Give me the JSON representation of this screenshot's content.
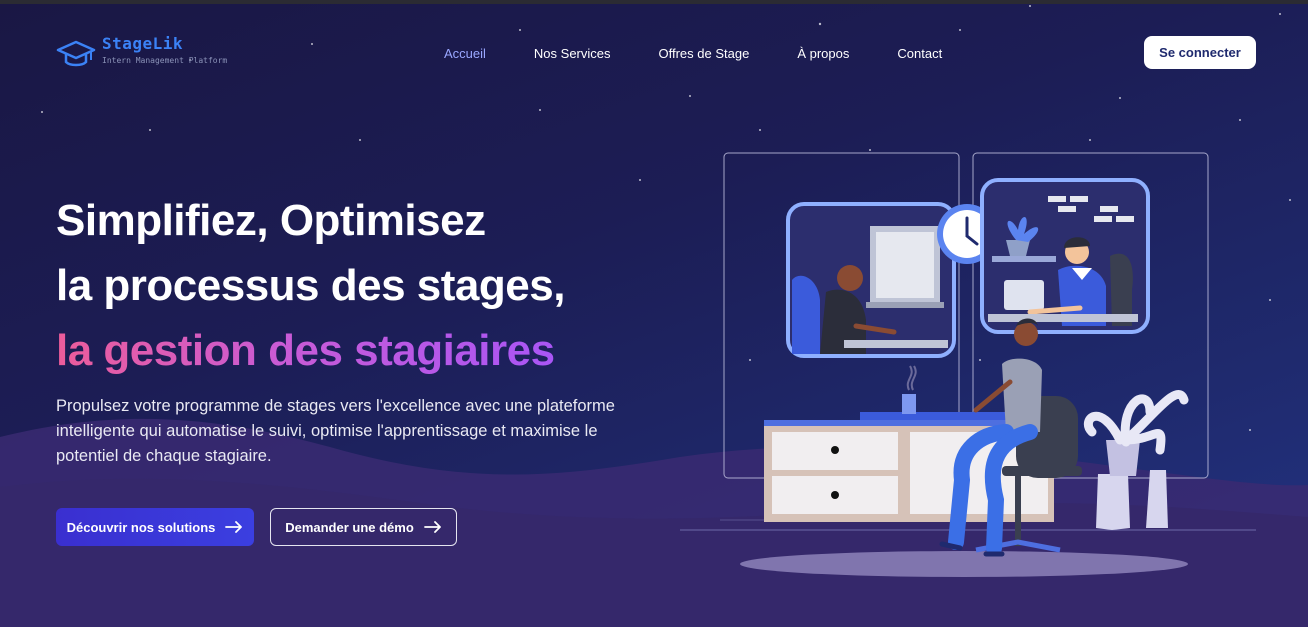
{
  "brand": {
    "name": "StageLik",
    "tagline": "Intern Management Platform",
    "accent": "#3b82f6"
  },
  "nav": {
    "items": [
      {
        "label": "Accueil",
        "active": true
      },
      {
        "label": "Nos Services",
        "active": false
      },
      {
        "label": "Offres de Stage",
        "active": false
      },
      {
        "label": "À propos",
        "active": false
      },
      {
        "label": "Contact",
        "active": false
      }
    ],
    "login_label": "Se connecter"
  },
  "hero": {
    "title_line1": "Simplifiez, Optimisez",
    "title_line2": "la processus des stages,",
    "title_line3": "la gestion des stagiaires",
    "subtitle": "Propulsez votre programme de stages vers l'excellence avec une plateforme intelligente qui automatise le suivi, optimise l'apprentissage et maximise le potentiel de chaque stagiaire.",
    "cta_primary": "Découvrir nos solutions",
    "cta_secondary": "Demander une démo"
  },
  "colors": {
    "background": "#1c1d55",
    "gradient_start": "#ec5c9a",
    "gradient_end": "#a855f7",
    "primary_button": "#3a2fd0"
  }
}
